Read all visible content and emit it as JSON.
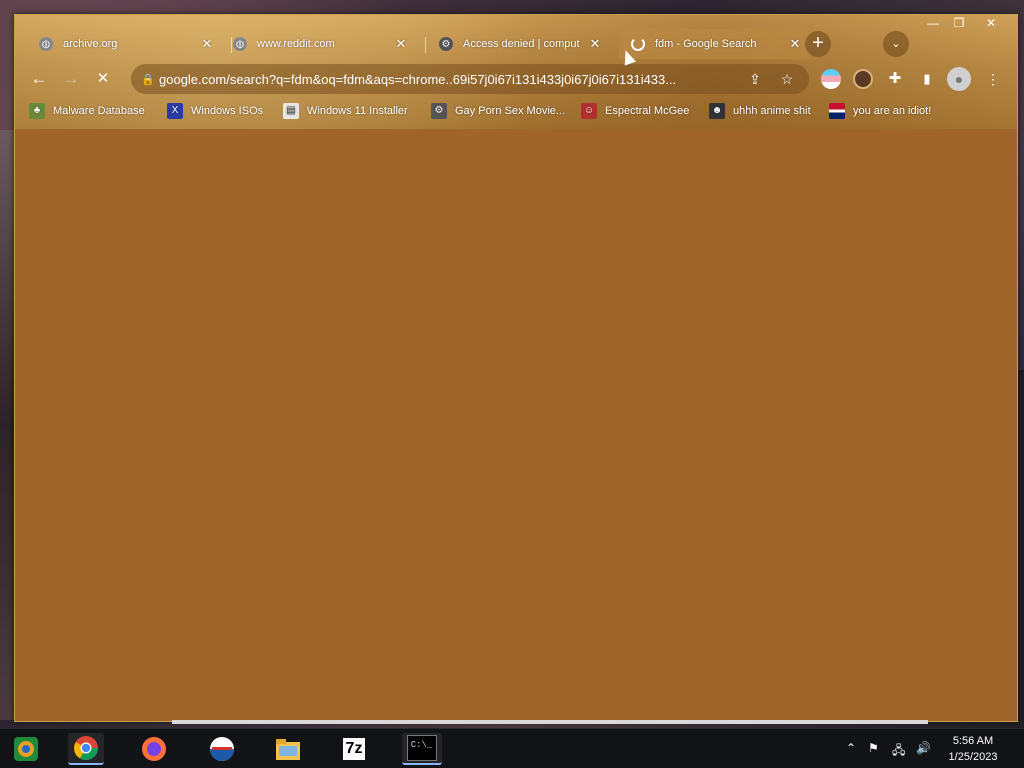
{
  "tabs": [
    {
      "title": "archive.org",
      "icon": "globe-icon"
    },
    {
      "title": "www.reddit.com",
      "icon": "globe-icon"
    },
    {
      "title": "Access denied | comput",
      "icon": "shield-icon"
    },
    {
      "title": "fdm - Google Search",
      "icon": "loading-icon"
    }
  ],
  "address_bar": {
    "url": "google.com/search?q=fdm&oq=fdm&aqs=chrome..69i57j0i67i131i433j0i67j0i67i131i433..."
  },
  "bookmarks": [
    {
      "label": "Malware Database",
      "icon": "leaf-icon"
    },
    {
      "label": "Windows ISOs",
      "icon": "x-icon"
    },
    {
      "label": "Windows 11 Installer",
      "icon": "page-icon"
    },
    {
      "label": "Gay Porn Sex Movie...",
      "icon": "gear-icon"
    },
    {
      "label": "Espectral McGee",
      "icon": "face-icon"
    },
    {
      "label": "uhhh anime shit",
      "icon": "anime-icon"
    },
    {
      "label": "you are an idiot!",
      "icon": "flag-icon"
    }
  ],
  "taskbar": {
    "apps": [
      "start-icon",
      "chrome-icon",
      "firefox-icon",
      "outlook-icon",
      "file-explorer-icon",
      "7zip-icon",
      "cmd-icon"
    ],
    "sevenzip_label": "7z",
    "cmd_label": "C:\\_"
  },
  "clock": {
    "time": "5:56 AM",
    "date": "1/25/2023"
  },
  "colors": {
    "accent": "#a0652a",
    "tab_bg": "#b98a45"
  }
}
